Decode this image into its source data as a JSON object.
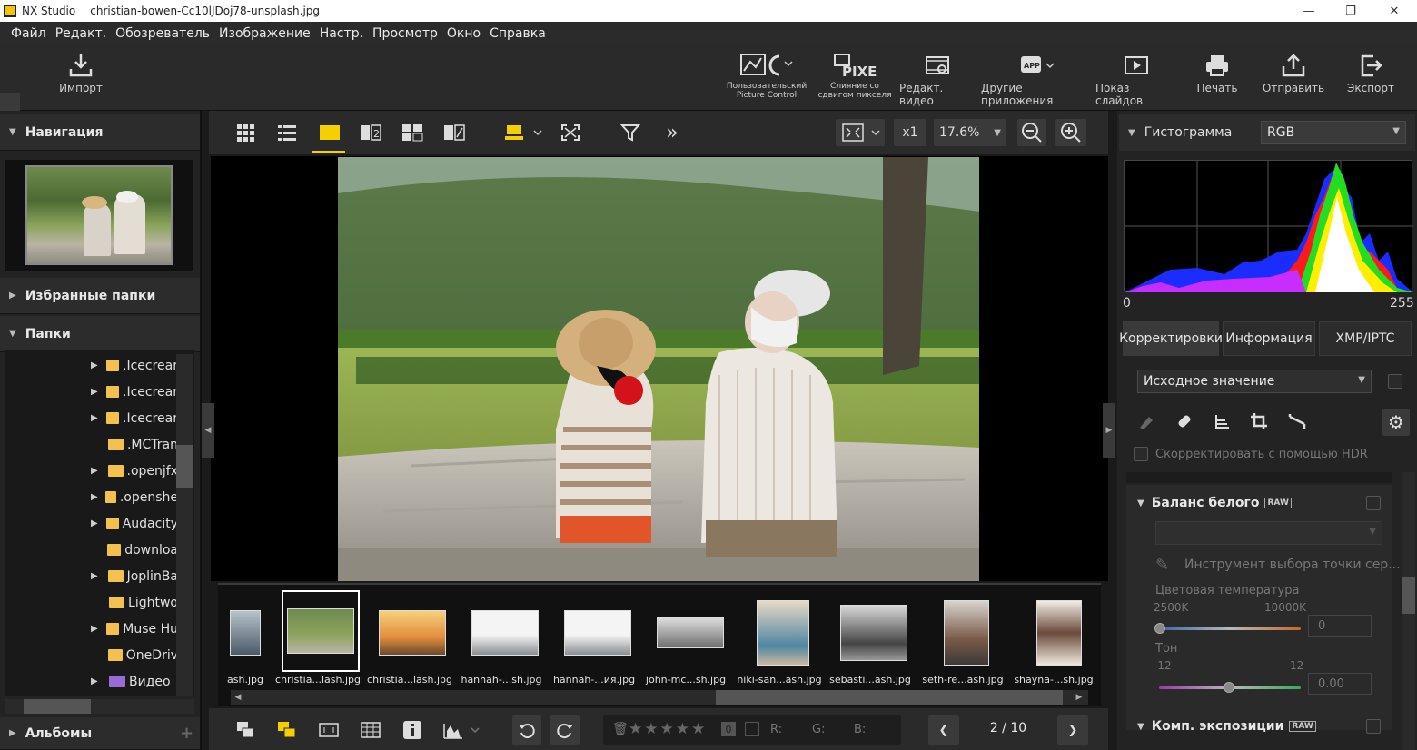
{
  "titlebar": {
    "app_name": "NX Studio",
    "file_name": "christian-bowen-Cc10lJDoj78-unsplash.jpg"
  },
  "menu": [
    "Файл",
    "Редакт.",
    "Обозреватель",
    "Изображение",
    "Настр.",
    "Просмотр",
    "Окно",
    "Справка"
  ],
  "toolbar": {
    "import": "Импорт",
    "picture_control": "Пользовательский Picture Control",
    "pixel_shift": "Слияние со сдвигом пикселя",
    "pixel_icon_text": "PIXEL",
    "edit_video": "Редакт. видео",
    "other_apps": "Другие приложения",
    "app_icon_text": "APP",
    "slideshow": "Показ слайдов",
    "print": "Печать",
    "send": "Отправить",
    "export": "Экспорт"
  },
  "left": {
    "navigation": "Навигация",
    "favorites": "Избранные папки",
    "folders": "Папки",
    "albums": "Альбомы",
    "folder_items": [
      ".Icecrear",
      ".Icecrear",
      ".Icecrear",
      ".MCTran",
      ".openjfx",
      ".openshе",
      "Audacity",
      "downloa",
      "JoplinBa",
      "Lightwo",
      "Muse Hu",
      "OneDriv",
      "Видео"
    ]
  },
  "viewbar": {
    "zoom_mult": "x1",
    "zoom_pct": "17.6%"
  },
  "filmstrip": {
    "labels": [
      "ash.jpg",
      "christia...lash.jpg",
      "christia...lash.jpg",
      "hannah-...sh.jpg",
      "hannah-...ия.jpg",
      "john-mc...sh.jpg",
      "niki-san...ash.jpg",
      "sebasti...ash.jpg",
      "seth-re...ash.jpg",
      "shayna-...sh.jpg"
    ],
    "selected_index": 1
  },
  "bottombar": {
    "rating_zero": "0",
    "r_label": "R:",
    "g_label": "G:",
    "b_label": "B:",
    "page": "2 / 10"
  },
  "right": {
    "histogram": "Гистограмма",
    "channel": "RGB",
    "hist_min": "0",
    "hist_max": "255",
    "tabs": [
      "Корректировки",
      "Информация",
      "XMP/IPTC"
    ],
    "preset": "Исходное значение",
    "hdr": "Скорректировать с помощью HDR",
    "wb_title": "Баланс белого",
    "raw": "RAW",
    "gray_tool": "Инструмент выбора точки сер...",
    "color_temp": "Цветовая температура",
    "temp_min": "2500K",
    "temp_max": "10000K",
    "temp_val": "0",
    "tone": "Тон",
    "tone_min": "-12",
    "tone_max": "12",
    "tone_val": "0.00",
    "exp_title": "Комп. экспозиции"
  },
  "colors": {
    "accent_yellow": "#f5d000",
    "panel": "#2a2a2a"
  }
}
